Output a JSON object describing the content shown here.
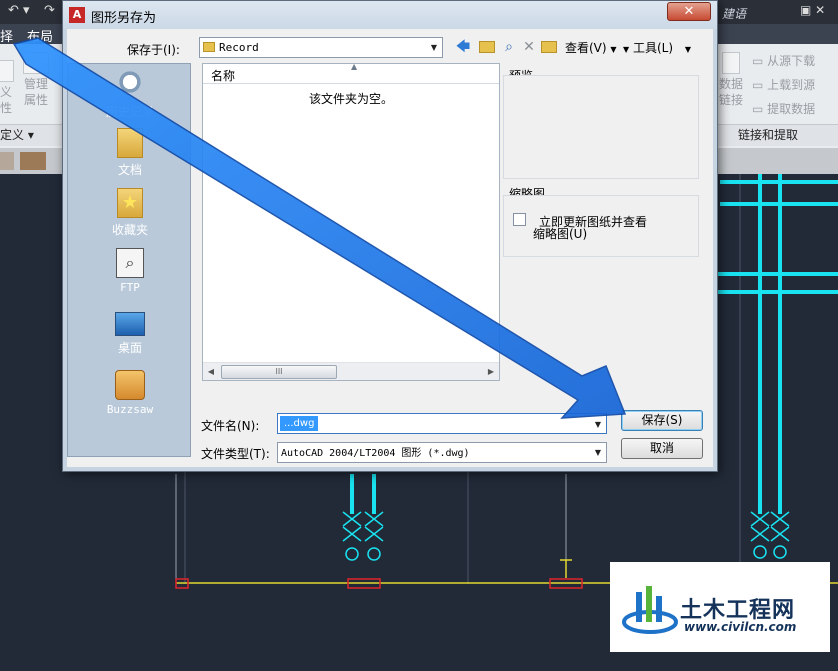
{
  "background_app": {
    "menu": [
      "择",
      "布局"
    ],
    "ribbon_left": [
      "义",
      "管理",
      "性",
      "属性"
    ],
    "ribbon_left_panel": "定义 ▾",
    "ribbon_right_tools": [
      "从源下载",
      "上载到源",
      "提取数据"
    ],
    "ribbon_right_tools_2": [
      "数据",
      "链接"
    ],
    "ribbon_right_panel": "链接和提取",
    "search_hint": "建语"
  },
  "dialog": {
    "app_icon": "A",
    "title": "图形另存为",
    "close_glyph": "✕",
    "save_in_label": "保存于(I):",
    "save_in_value": "Record",
    "toolbar": {
      "back_icon": "back-arrow-icon",
      "up_folder_icon": "up-folder-icon",
      "search_web_icon": "search-web-icon",
      "delete_icon": "delete-icon",
      "new_folder_icon": "new-folder-icon",
      "view_label": "查看(V)",
      "tools_label": "工具(L)"
    },
    "places": [
      {
        "label": "历史记录",
        "icon": "history-icon"
      },
      {
        "label": "文档",
        "icon": "documents-folder-icon"
      },
      {
        "label": "收藏夹",
        "icon": "favorites-folder-icon"
      },
      {
        "label": "FTP",
        "icon": "ftp-icon"
      },
      {
        "label": "桌面",
        "icon": "desktop-icon"
      },
      {
        "label": "Buzzsaw",
        "icon": "buzzsaw-icon"
      }
    ],
    "file_list": {
      "column_name": "名称",
      "empty_message": "该文件夹为空。"
    },
    "preview_label": "预览",
    "thumbnail_label": "缩略图",
    "thumbnail_checkbox_label_line1": "立即更新图纸并查看",
    "thumbnail_checkbox_label_line2": "缩略图(U)",
    "thumbnail_checked": false,
    "filename_label": "文件名(N):",
    "filename_value": "...dwg",
    "filetype_label": "文件类型(T):",
    "filetype_value": "AutoCAD 2004/LT2004 图形 (*.dwg)",
    "save_button": "保存(S)",
    "cancel_button": "取消"
  },
  "watermark": {
    "title": "土木工程网",
    "url": "www.civilcn.com"
  },
  "colors": {
    "arrow": "#1e7ff0",
    "cad_background": "#222a38",
    "cad_cyan": "#19e3f0",
    "cad_yellow": "#e3d830",
    "cad_red": "#e0242b"
  }
}
